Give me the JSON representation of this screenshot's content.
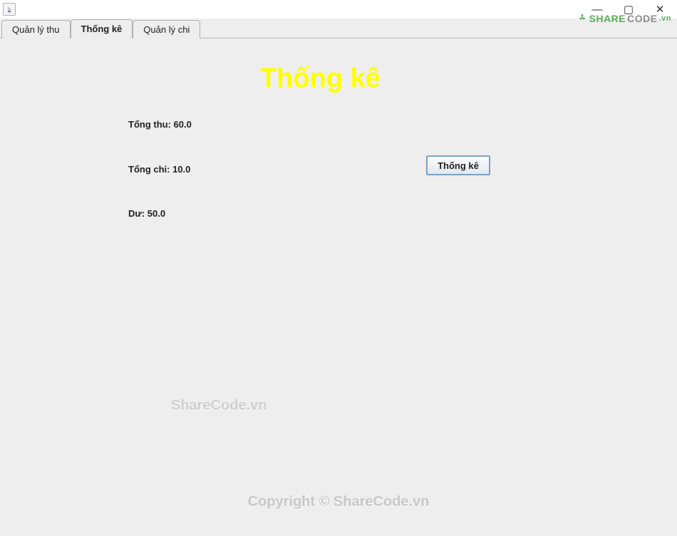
{
  "window": {
    "minimize": "—",
    "maximize": "▢",
    "close": "✕"
  },
  "tabs": {
    "revenue": "Quản lý thu",
    "statistics": "Thống kê",
    "expense": "Quản lý chi"
  },
  "page": {
    "title": "Thống kê"
  },
  "stats": {
    "income_label": "Tổng thu: 60.0",
    "expense_label": "Tổng chi: 10.0",
    "balance_label": "Dư: 50.0",
    "button_label": "Thống kê"
  },
  "watermark": {
    "share": "SHARE",
    "code": "CODE",
    "vn": ".vn",
    "middle": "ShareCode.vn",
    "footer": "Copyright © ShareCode.vn"
  }
}
